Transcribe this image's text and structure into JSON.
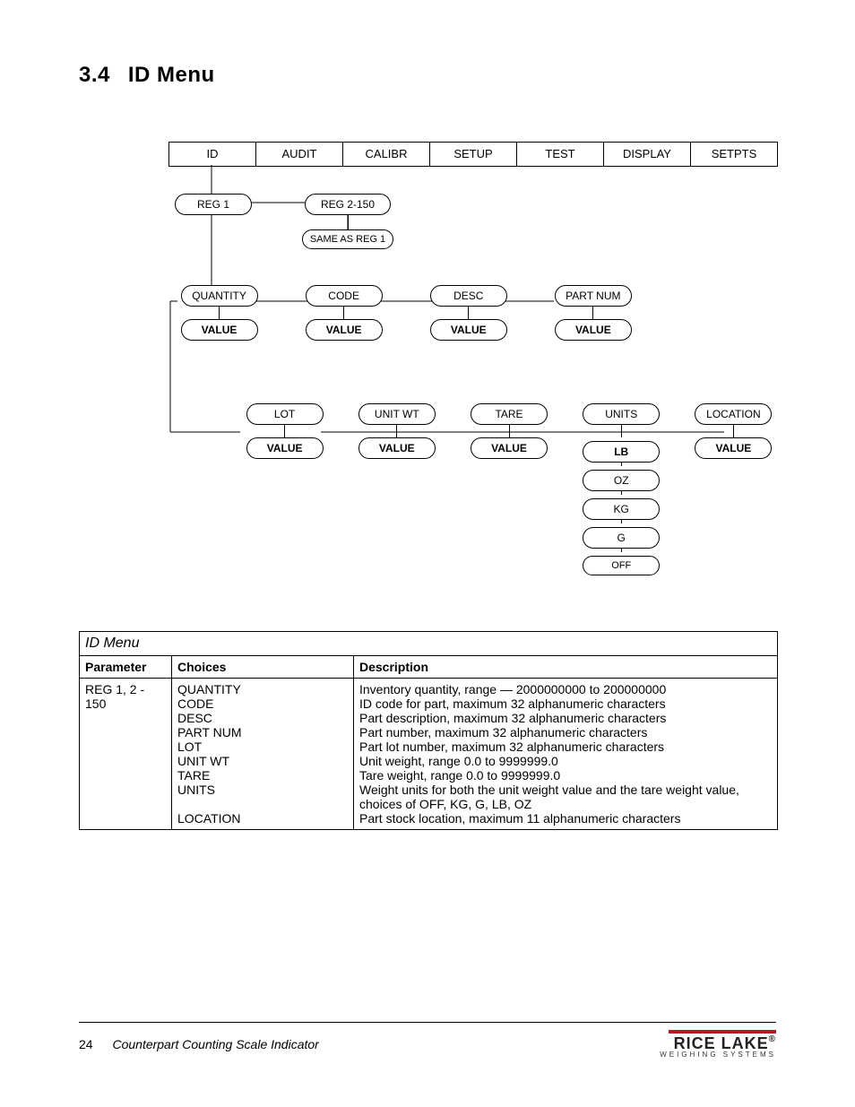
{
  "section": {
    "number": "3.4",
    "title": "ID Menu"
  },
  "menu": [
    "ID",
    "AUDIT",
    "CALIBR",
    "SETUP",
    "TEST",
    "DISPLAY",
    "SETPTS"
  ],
  "reg_row": {
    "reg1": "REG 1",
    "reg2": "REG 2-150",
    "same": "SAME AS REG 1"
  },
  "row_a": {
    "items": [
      "QUANTITY",
      "CODE",
      "DESC",
      "PART NUM"
    ],
    "values": [
      "VALUE",
      "VALUE",
      "VALUE",
      "VALUE"
    ]
  },
  "row_b": {
    "items": [
      "LOT",
      "UNIT WT",
      "TARE",
      "UNITS",
      "LOCATION"
    ],
    "values": [
      "VALUE",
      "VALUE",
      "VALUE",
      "LB",
      "VALUE"
    ],
    "units_extra": [
      "OZ",
      "KG",
      "G",
      "OFF"
    ]
  },
  "table": {
    "title": "ID Menu",
    "headers": [
      "Parameter",
      "Choices",
      "Description"
    ],
    "param": "REG 1, 2 - 150",
    "rows": [
      {
        "choice": "QUANTITY",
        "desc": "Inventory quantity, range — 2000000000 to 200000000"
      },
      {
        "choice": "CODE",
        "desc": "ID code for part, maximum 32 alphanumeric characters"
      },
      {
        "choice": "DESC",
        "desc": "Part description, maximum 32 alphanumeric characters"
      },
      {
        "choice": "PART NUM",
        "desc": "Part number, maximum 32 alphanumeric characters"
      },
      {
        "choice": "LOT",
        "desc": "Part lot number, maximum 32 alphanumeric characters"
      },
      {
        "choice": "UNIT WT",
        "desc": "Unit weight, range 0.0 to 9999999.0"
      },
      {
        "choice": "TARE",
        "desc": "Tare weight, range 0.0 to 9999999.0"
      },
      {
        "choice": "UNITS",
        "desc": "Weight units for both the unit weight value and the tare weight value, choices of OFF, KG, G, LB, OZ"
      },
      {
        "choice": "LOCATION",
        "desc": "Part stock location, maximum 11 alphanumeric characters"
      }
    ]
  },
  "footer": {
    "page": "24",
    "doc": "Counterpart Counting Scale Indicator",
    "brand": "RICE LAKE",
    "sub": "WEIGHING SYSTEMS"
  }
}
